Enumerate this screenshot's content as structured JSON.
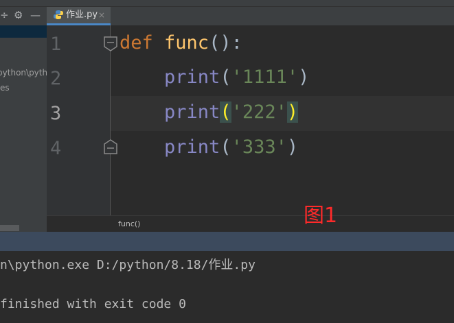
{
  "tab": {
    "filename": "作业.py",
    "close_glyph": "×"
  },
  "toolbar": {
    "divider_glyph": "÷",
    "settings_glyph": "⚙",
    "minimize_glyph": "—"
  },
  "sidebar": {
    "path_fragment": "\\python\\pyth",
    "extra_fragment": "es"
  },
  "editor": {
    "line_numbers": [
      "1",
      "2",
      "3",
      "4"
    ],
    "current_line": 3,
    "lines": [
      {
        "kw": "def ",
        "fn": "func",
        "tail": "():"
      },
      {
        "indent": "    ",
        "builtin": "print",
        "open": "(",
        "str": "'1111'",
        "close": ")"
      },
      {
        "indent": "    ",
        "builtin": "print",
        "open": "(",
        "str": "'222'",
        "close": ")"
      },
      {
        "indent": "    ",
        "builtin": "print",
        "open": "(",
        "str": "'333'",
        "close": ")"
      }
    ]
  },
  "breadcrumb": {
    "label": "func()"
  },
  "annotation": {
    "label": "图1"
  },
  "console": {
    "lines": [
      "n\\python.exe D:/python/8.18/作业.py",
      "",
      "finished with exit code 0"
    ]
  },
  "colors": {
    "keyword": "#cc7832",
    "function": "#ffc66d",
    "builtin": "#8888c6",
    "string": "#6a8759",
    "bracket_highlight": "#ffef28",
    "annotation": "#ff2a2a"
  }
}
